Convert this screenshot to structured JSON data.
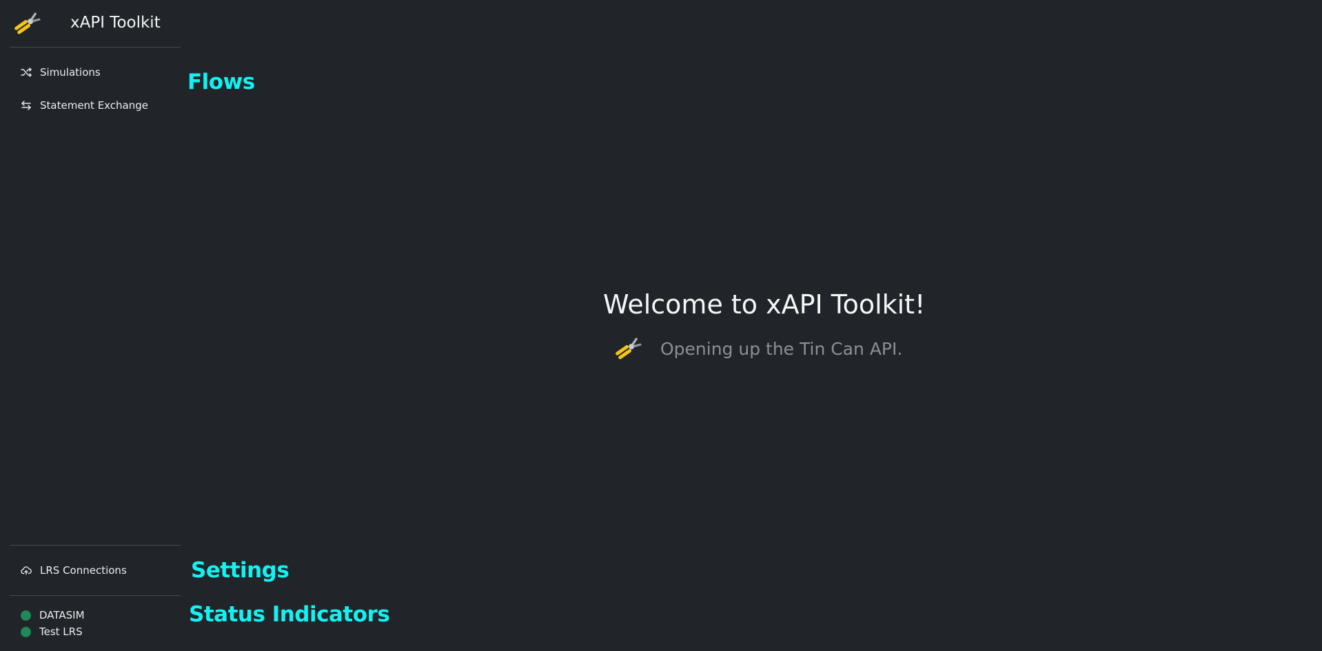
{
  "app": {
    "title": "xAPI Toolkit",
    "logo_icon": "pliers-icon"
  },
  "sections": {
    "flows": "Flows",
    "settings": "Settings",
    "status": "Status Indicators"
  },
  "sidebar": {
    "flows_items": [
      {
        "label": "Simulations",
        "icon": "shuffle-icon"
      },
      {
        "label": "Statement Exchange",
        "icon": "exchange-arrows-icon"
      }
    ],
    "settings_items": [
      {
        "label": "LRS Connections",
        "icon": "cloud-upload-icon"
      }
    ],
    "status_items": [
      {
        "label": "DATASIM",
        "status": "ok",
        "color": "#1e8a57"
      },
      {
        "label": "Test LRS",
        "status": "ok",
        "color": "#1e8a57"
      }
    ]
  },
  "welcome": {
    "title": "Welcome to xAPI Toolkit!",
    "subtitle": "Opening up the Tin Can API.",
    "icon": "pliers-icon"
  },
  "colors": {
    "background": "#212429",
    "accent_heading": "#12f2f2",
    "status_ok": "#1e8a57"
  }
}
